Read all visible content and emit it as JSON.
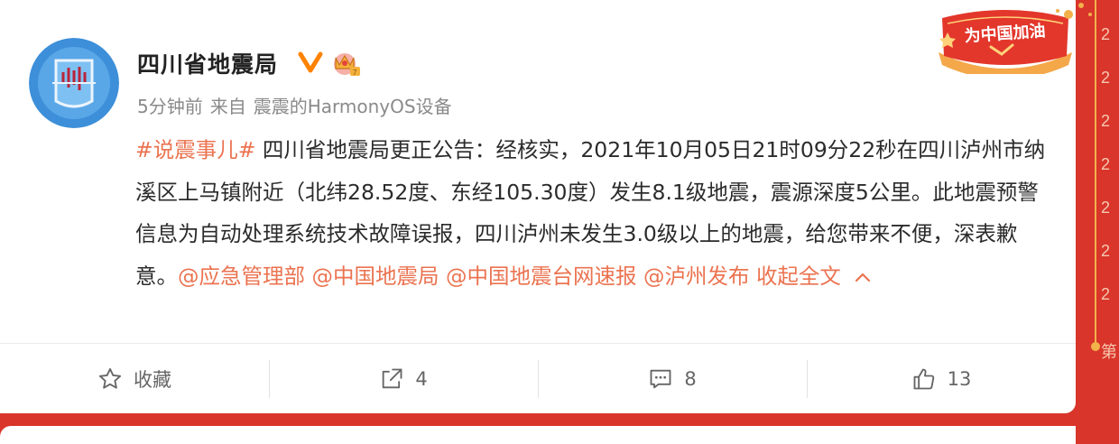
{
  "post": {
    "author": "四川省地震局",
    "time": "5分钟前",
    "source_prefix": "来自",
    "source": "震震的HarmonyOS设备",
    "hashtag": "#说震事儿#",
    "text": " 四川省地震局更正公告：经核实，2021年10月05日21时09分22秒在四川泸州市纳溪区上马镇附近（北纬28.52度、东经105.30度）发生8.1级地震，震源深度5公里。此地震预警信息为自动处理系统技术故障误报，四川泸州未发生3.0级以上的地震，给您带来不便，深表歉意。",
    "mentions": [
      "@应急管理部",
      "@中国地震局",
      "@中国地震台网速报",
      "@泸州发布"
    ],
    "collapse_label": "收起全文"
  },
  "actions": {
    "favorite_label": "收藏",
    "repost_count": "4",
    "comment_count": "8",
    "like_count": "13"
  },
  "banner": {
    "text": "为中国加油"
  },
  "side_strip": {
    "digits": [
      "2",
      "2",
      "2",
      "2",
      "2",
      "2",
      "2",
      "2"
    ],
    "char": "第"
  },
  "colors": {
    "background": "#d9352b",
    "link": "#eb7350",
    "verified": "#ff8200",
    "text": "#2b2b2b"
  },
  "icons": [
    "verified-icon",
    "crown-badge-icon",
    "chevron-up-icon",
    "star-icon",
    "share-icon",
    "comment-icon",
    "thumbs-up-icon"
  ]
}
